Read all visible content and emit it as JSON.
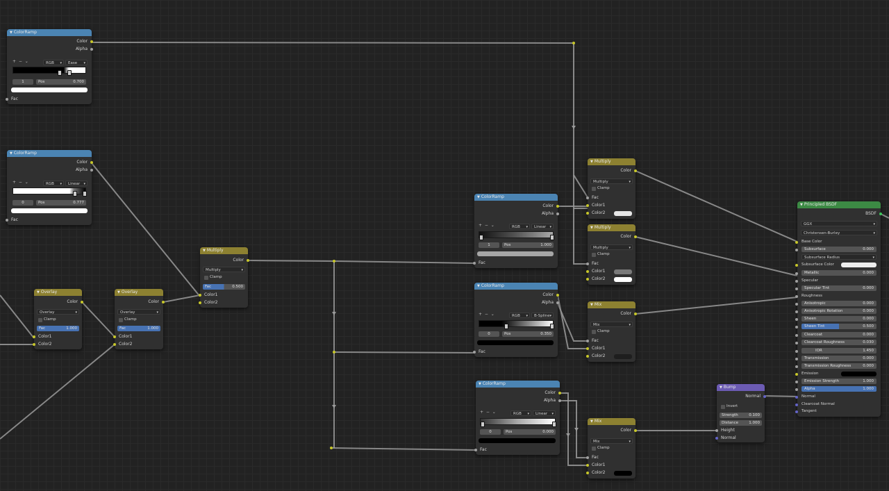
{
  "colors": {
    "colorramp_header": "#4b84b3",
    "mix_header": "#8d8131",
    "shader_header": "#3c8a44",
    "vector_header": "#6c5bb3",
    "link": "#9a9a9a",
    "socket_color": "#c7c729",
    "socket_float": "#a0a0a0",
    "socket_vector": "#6363c7"
  },
  "cr1": {
    "title": "ColorRamp",
    "out_color": "Color",
    "out_alpha": "Alpha",
    "mode": "RGB",
    "interp": "Ease",
    "index": "1",
    "pos_label": "Pos",
    "pos_value": "0.700",
    "in_fac": "Fac"
  },
  "cr2": {
    "title": "ColorRamp",
    "out_color": "Color",
    "out_alpha": "Alpha",
    "mode": "RGB",
    "interp": "Linear",
    "index": "0",
    "pos_label": "Pos",
    "pos_value": "0.777",
    "in_fac": "Fac"
  },
  "ov1": {
    "title": "Overlay",
    "out_color": "Color",
    "blend": "Overlay",
    "clamp": "Clamp",
    "fac_label": "Fac",
    "fac_value": "1.000",
    "in_c1": "Color1",
    "in_c2": "Color2"
  },
  "ov2": {
    "title": "Overlay",
    "out_color": "Color",
    "blend": "Overlay",
    "clamp": "Clamp",
    "fac_label": "Fac",
    "fac_value": "1.000",
    "in_c1": "Color1",
    "in_c2": "Color2"
  },
  "mul": {
    "title": "Multiply",
    "out_color": "Color",
    "blend": "Multiply",
    "clamp": "Clamp",
    "fac_label": "Fac",
    "fac_value": "0.500",
    "in_c1": "Color1",
    "in_c2": "Color2"
  },
  "cr3": {
    "title": "ColorRamp",
    "out_color": "Color",
    "out_alpha": "Alpha",
    "mode": "RGB",
    "interp": "Linear",
    "index": "1",
    "pos_label": "Pos",
    "pos_value": "1.000",
    "in_fac": "Fac"
  },
  "cr4": {
    "title": "ColorRamp",
    "out_color": "Color",
    "out_alpha": "Alpha",
    "mode": "RGB",
    "interp": "B-Spline",
    "index": "0",
    "pos_label": "Pos",
    "pos_value": "0.350",
    "in_fac": "Fac"
  },
  "cr5": {
    "title": "ColorRamp",
    "out_color": "Color",
    "out_alpha": "Alpha",
    "mode": "RGB",
    "interp": "Linear",
    "index": "0",
    "pos_label": "Pos",
    "pos_value": "0.000",
    "in_fac": "Fac"
  },
  "m1": {
    "title": "Multiply",
    "out_color": "Color",
    "blend": "Multiply",
    "clamp": "Clamp",
    "in_fac": "Fac",
    "in_c1": "Color1",
    "in_c2": "Color2"
  },
  "m2": {
    "title": "Multiply",
    "out_color": "Color",
    "blend": "Multiply",
    "clamp": "Clamp",
    "in_fac": "Fac",
    "in_c1": "Color1",
    "in_c2": "Color2"
  },
  "mix1": {
    "title": "Mix",
    "out_color": "Color",
    "blend": "Mix",
    "clamp": "Clamp",
    "in_fac": "Fac",
    "in_c1": "Color1",
    "in_c2": "Color2"
  },
  "mix2": {
    "title": "Mix",
    "out_color": "Color",
    "blend": "Mix",
    "clamp": "Clamp",
    "in_fac": "Fac",
    "in_c1": "Color1",
    "in_c2": "Color2"
  },
  "bump": {
    "title": "Bump",
    "out_normal": "Normal",
    "invert": "Invert",
    "strength_label": "Strength",
    "strength_value": "0.100",
    "distance_label": "Distance",
    "distance_value": "1.000",
    "in_height": "Height",
    "in_normal": "Normal"
  },
  "pb": {
    "title": "Principled BSDF",
    "out_bsdf": "BSDF",
    "distribution": "GGX",
    "subsurface_method": "Christensen-Burley",
    "base_color": "Base Color",
    "subsurface": {
      "label": "Subsurface",
      "value": "0.000"
    },
    "subsurface_radius": "Subsurface Radius",
    "subsurface_color": "Subsurface Color",
    "metallic": {
      "label": "Metallic",
      "value": "0.000"
    },
    "specular": "Specular",
    "specular_tint": {
      "label": "Specular Tint",
      "value": "0.000"
    },
    "roughness": "Roughness",
    "anisotropic": {
      "label": "Anisotropic",
      "value": "0.000"
    },
    "anisotropic_rotation": {
      "label": "Anisotropic Rotation",
      "value": "0.000"
    },
    "sheen": {
      "label": "Sheen",
      "value": "0.000"
    },
    "sheen_tint": {
      "label": "Sheen Tint",
      "value": "0.500"
    },
    "clearcoat": {
      "label": "Clearcoat",
      "value": "0.000"
    },
    "clearcoat_roughness": {
      "label": "Clearcoat Roughness",
      "value": "0.030"
    },
    "ior": {
      "label": "IOR",
      "value": "1.450"
    },
    "transmission": {
      "label": "Transmission",
      "value": "0.000"
    },
    "transmission_roughness": {
      "label": "Transmission Roughness",
      "value": "0.000"
    },
    "emission": "Emission",
    "emission_strength": {
      "label": "Emission Strength",
      "value": "1.000"
    },
    "alpha": {
      "label": "Alpha",
      "value": "1.000"
    },
    "normal": "Normal",
    "clearcoat_normal": "Clearcoat Normal",
    "tangent": "Tangent"
  },
  "icons": {
    "collapse": "triangle-down-icon",
    "add": "plus-icon",
    "remove": "minus-icon",
    "menu": "chevron-down-icon",
    "reroute": "arrow-down-icon"
  }
}
